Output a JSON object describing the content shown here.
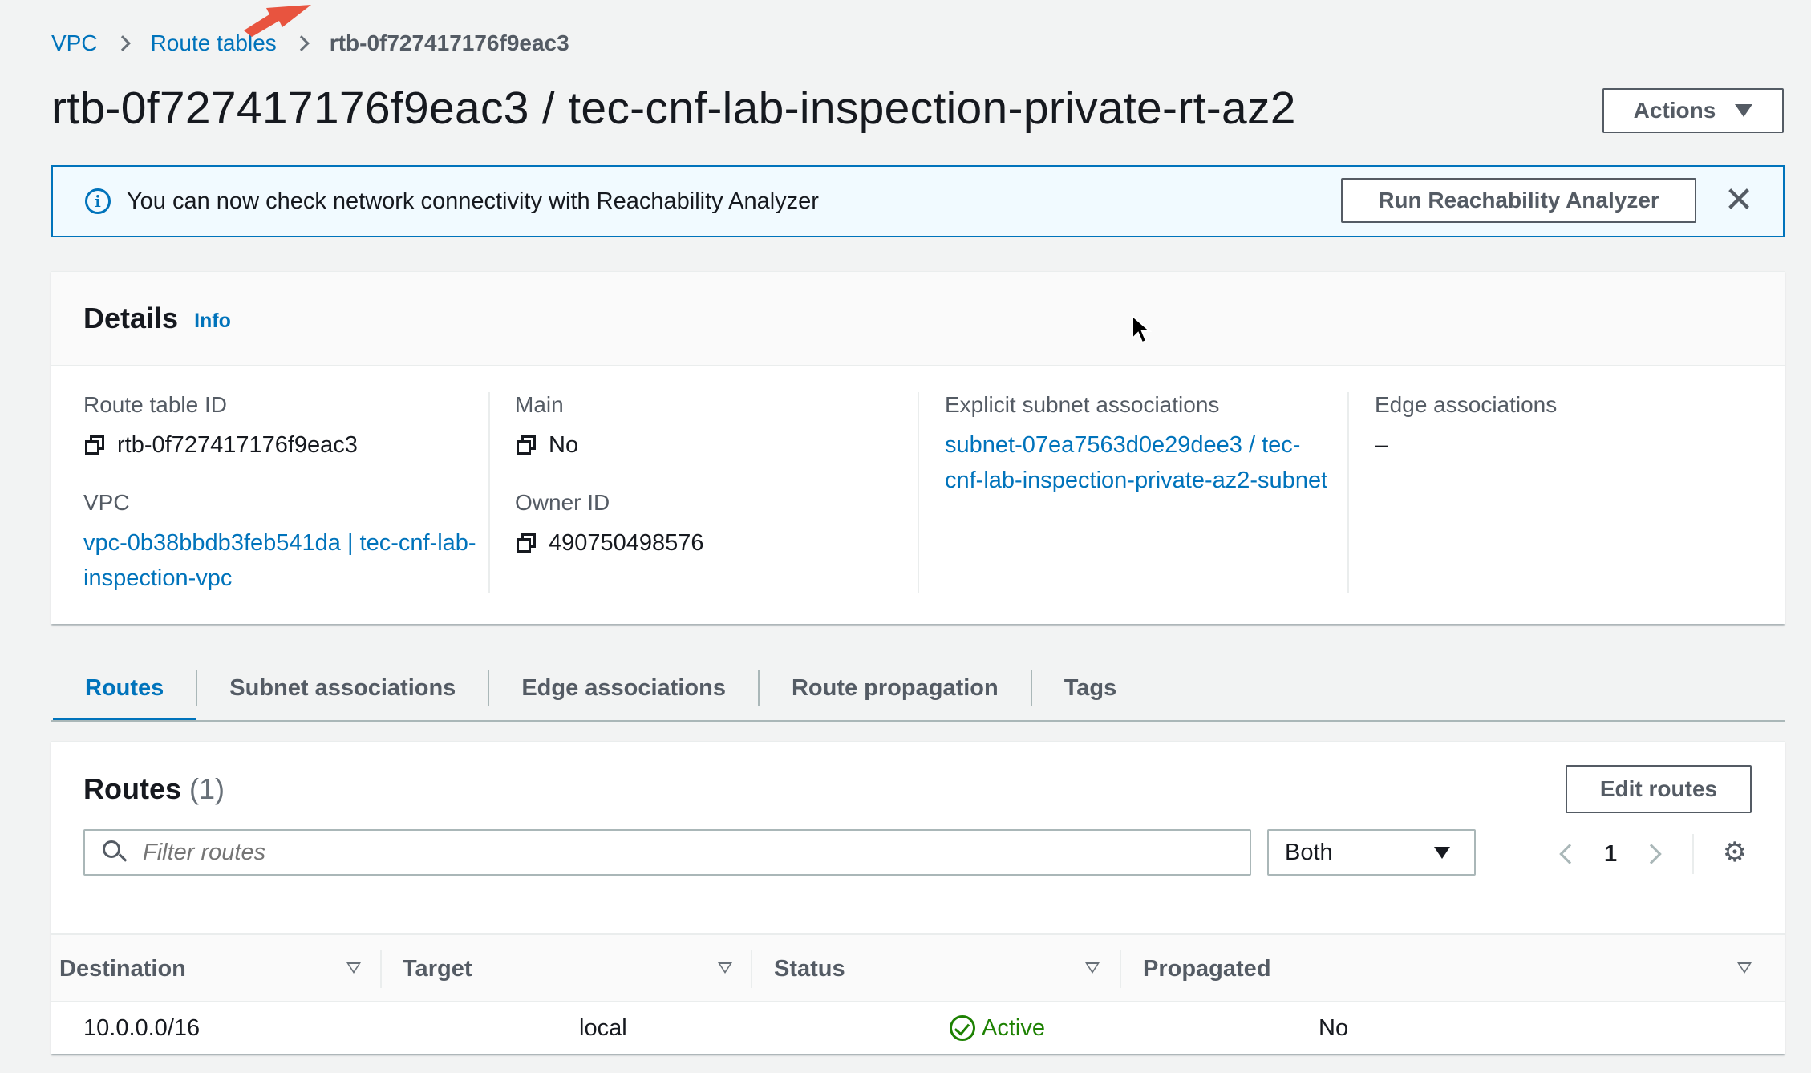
{
  "breadcrumb": {
    "vpc": "VPC",
    "route_tables": "Route tables",
    "current": "rtb-0f727417176f9eac3"
  },
  "page": {
    "title": "rtb-0f727417176f9eac3 / tec-cnf-lab-inspection-private-rt-az2",
    "actions_label": "Actions"
  },
  "banner": {
    "text": "You can now check network connectivity with Reachability Analyzer",
    "button_label": "Run Reachability Analyzer",
    "close_symbol": "✕"
  },
  "details": {
    "title": "Details",
    "info_label": "Info",
    "route_table_id_label": "Route table ID",
    "route_table_id": "rtb-0f727417176f9eac3",
    "vpc_label": "VPC",
    "vpc_value": "vpc-0b38bbdb3feb541da | tec-cnf-lab-inspection-vpc",
    "main_label": "Main",
    "main_value": "No",
    "owner_label": "Owner ID",
    "owner_value": "490750498576",
    "subnet_assoc_label": "Explicit subnet associations",
    "subnet_assoc_value": "subnet-07ea7563d0e29dee3 / tec-cnf-lab-inspection-private-az2-subnet",
    "edge_assoc_label": "Edge associations",
    "edge_assoc_value": "–"
  },
  "tabs": [
    {
      "label": "Routes"
    },
    {
      "label": "Subnet associations"
    },
    {
      "label": "Edge associations"
    },
    {
      "label": "Route propagation"
    },
    {
      "label": "Tags"
    }
  ],
  "routes": {
    "title": "Routes",
    "count": "(1)",
    "edit_label": "Edit routes",
    "filter_placeholder": "Filter routes",
    "select_value": "Both",
    "page_number": "1",
    "columns": [
      "Destination",
      "Target",
      "Status",
      "Propagated"
    ],
    "rows": [
      {
        "destination": "10.0.0.0/16",
        "target": "local",
        "status": "Active",
        "propagated": "No"
      }
    ]
  },
  "colors": {
    "link": "#0073bb",
    "success": "#1d8102",
    "annotation_arrow": "#e8543f"
  },
  "icons": [
    "info-icon",
    "copy-icon",
    "search-icon",
    "gear-icon",
    "check-circle-icon",
    "close-icon",
    "caret-down-icon",
    "chevron-left-icon",
    "chevron-right-icon"
  ]
}
